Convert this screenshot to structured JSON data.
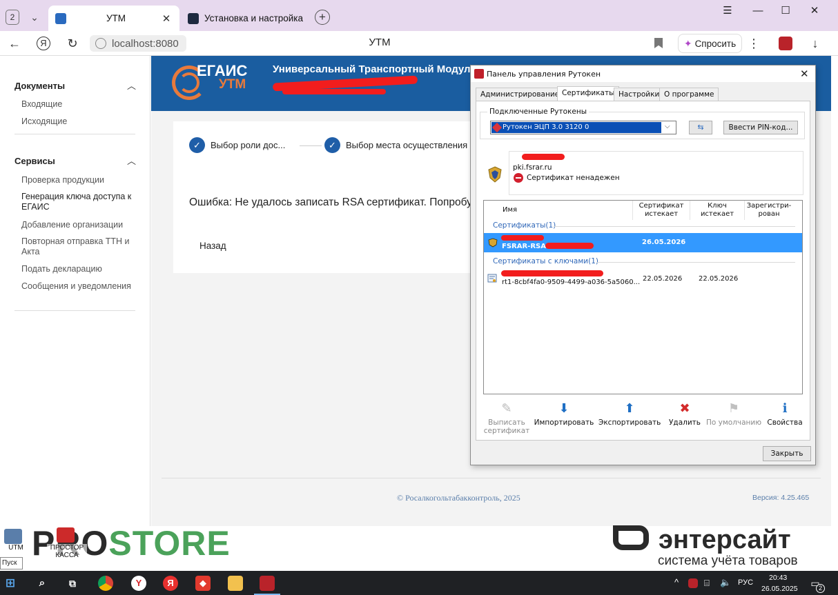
{
  "browser": {
    "tab_count": "2",
    "tabs": [
      {
        "title": "УТМ",
        "close": "✕"
      },
      {
        "title": "Установка и настройка УТ"
      }
    ],
    "new_tab": "+",
    "window_controls": {
      "menu": "☰",
      "minimize": "—",
      "maximize": "☐",
      "close": "✕"
    },
    "back": "←",
    "yandex": "Я",
    "reload": "↻",
    "url": "localhost:8080",
    "page_title": "УТМ",
    "ask_label": "Спросить",
    "more": "⋮",
    "download": "↓"
  },
  "sidebar": {
    "sections": [
      {
        "title": "Документы",
        "items": [
          "Входящие",
          "Исходящие"
        ]
      },
      {
        "title": "Сервисы",
        "items": [
          "Проверка продукции",
          "Генерация ключа доступа к ЕГАИС",
          "Добавление организации",
          "Повторная отправка ТТН и Акта",
          "Подать декларацию",
          "Сообщения и уведомления"
        ]
      }
    ],
    "chevron": "︿"
  },
  "banner": {
    "logo_top": "ЕГАИС",
    "logo_bottom": "УТМ",
    "title": "Универсальный Транспортный Модуль"
  },
  "wizard": {
    "steps": [
      "Выбор роли дос...",
      "Выбор места осуществления"
    ],
    "check": "✓",
    "error": "Ошибка: Не удалось записать RSA сертификат. Попробуй",
    "back_label": "Назад"
  },
  "footer": {
    "copyright": "© Росалкогольтабакконтроль, 2025",
    "version": "Версия: 4.25.465"
  },
  "dialog": {
    "title": "Панель управления Рутокен",
    "close": "✕",
    "tabs": [
      "Администрирование",
      "Сертификаты",
      "Настройки",
      "О программе"
    ],
    "connected_label": "Подключенные Рутокены",
    "token_selected": "Рутокен ЭЦП 3.0 3120 0",
    "combo_arrow": "⌵",
    "refresh": "⇆",
    "pin_button": "Ввести PIN-код...",
    "cert_domain": "pki.fsrar.ru",
    "untrusted": "Сертификат ненадежен",
    "columns": [
      "Имя",
      "Сертификат истекает",
      "Ключ истекает",
      "Зарегистри-рован"
    ],
    "groups": [
      {
        "title": "Сертификаты(1)",
        "rows": [
          {
            "name": "FSRAR-RSA-0",
            "cert_expires": "26.05.2026",
            "key_expires": ""
          }
        ]
      },
      {
        "title": "Сертификаты с ключами(1)",
        "rows": [
          {
            "name": "rt1-8cbf4fa0-9509-4499-a036-5a5060...",
            "cert_expires": "22.05.2026",
            "key_expires": "22.05.2026"
          }
        ]
      }
    ],
    "toolbar": [
      {
        "label": "Выписать сертификат",
        "icon": "new-certificate-icon",
        "glyph": "✎",
        "enabled": false
      },
      {
        "label": "Импортировать",
        "icon": "import-icon",
        "glyph": "⬇",
        "enabled": true
      },
      {
        "label": "Экспортировать",
        "icon": "export-icon",
        "glyph": "⬆",
        "enabled": true
      },
      {
        "label": "Удалить",
        "icon": "delete-icon",
        "glyph": "✖",
        "enabled": true
      },
      {
        "label": "По умолчанию",
        "icon": "flag-icon",
        "glyph": "⚑",
        "enabled": false
      },
      {
        "label": "Свойства",
        "icon": "info-icon",
        "glyph": "ℹ",
        "enabled": true
      }
    ],
    "close_button": "Закрыть"
  },
  "desktop": {
    "brand_left_a": "PRO",
    "brand_left_b": "STORE",
    "brand_right": "энтерсайт",
    "brand_right_sub": "система учёта товаров",
    "icons": [
      "UTM",
      "ПРОСТОР КАССА"
    ],
    "start_tooltip": "Пуск"
  },
  "taskbar": {
    "lang": "РУС",
    "time": "20:43",
    "date": "26.05.2025",
    "notifications": "2",
    "tray_chevron": "^"
  },
  "colors": {
    "banner": "#1a5da0",
    "accent_orange": "#e87a3c",
    "step_check": "#1f5ea8",
    "selection": "#3399ff",
    "redaction": "#f21d1d"
  }
}
